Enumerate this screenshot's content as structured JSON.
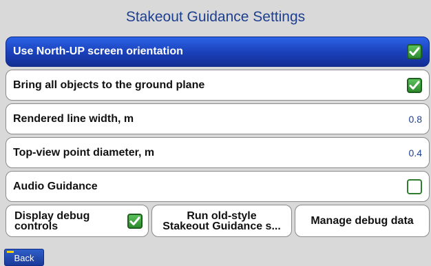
{
  "header": {
    "title": "Stakeout Guidance Settings"
  },
  "settings": [
    {
      "label": "Use North-UP screen orientation",
      "type": "checkbox",
      "checked": true,
      "selected": true
    },
    {
      "label": "Bring all objects to the ground plane",
      "type": "checkbox",
      "checked": true
    },
    {
      "label": "Rendered line width, m",
      "type": "value",
      "value": "0.8"
    },
    {
      "label": "Top-view point diameter, m",
      "type": "value",
      "value": "0.4"
    },
    {
      "label": "Audio Guidance",
      "type": "checkbox",
      "checked": false
    }
  ],
  "buttons": {
    "debug_controls": {
      "label_line1": "Display debug",
      "label_line2": "controls",
      "checked": true
    },
    "old_style": {
      "label_line1": "Run old-style",
      "label_line2": "Stakeout Guidance s..."
    },
    "manage_debug": {
      "label": "Manage debug data"
    }
  },
  "footer": {
    "back_label": "Back"
  },
  "colors": {
    "title": "#1d3f8f",
    "selected_row": "#1a3fb8",
    "check_green": "#2e8b2e",
    "background": "#d9d9d9"
  }
}
